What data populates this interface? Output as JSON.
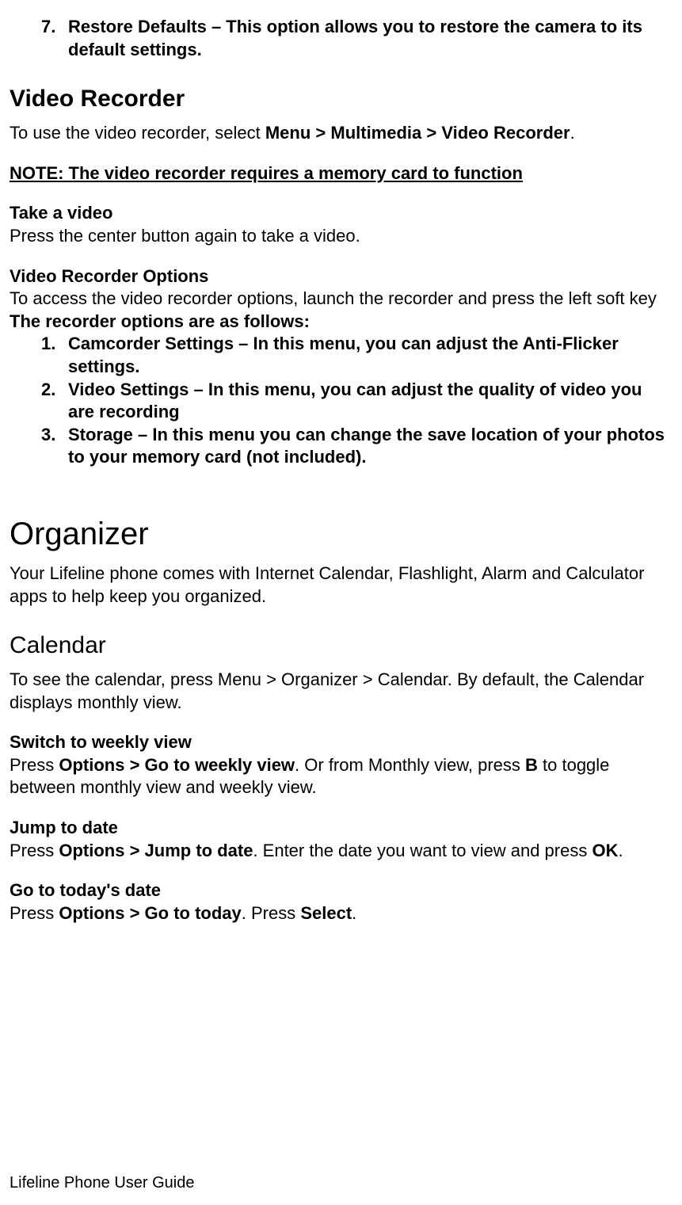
{
  "topList": {
    "num": "7.",
    "text": "Restore Defaults – This option allows you to restore the camera to its default settings."
  },
  "videoRecorder": {
    "heading": "Video Recorder",
    "intro_pre": "To use the video recorder, select ",
    "intro_bold": "Menu > Multimedia > Video Recorder",
    "intro_post": ".",
    "note": "NOTE: The video recorder requires a memory card to function",
    "takeHeading": "Take a video",
    "takeText": "Press the center button again to take a video.",
    "optionsHeading": "Video Recorder Options",
    "optionsText": "To access the video recorder options, launch the recorder and press the left soft key",
    "optionsFollows": "The recorder options are as follows:",
    "items": [
      {
        "num": "1.",
        "text": "Camcorder Settings – In this menu, you can adjust the Anti-Flicker settings."
      },
      {
        "num": "2.",
        "text": "Video Settings – In this menu, you can adjust the quality of video you are recording"
      },
      {
        "num": "3.",
        "text": "Storage – In this menu you can change the save location of your photos to your memory card (not included)."
      }
    ]
  },
  "organizer": {
    "heading": "Organizer",
    "intro": "Your Lifeline phone comes with Internet Calendar, Flashlight, Alarm and Calculator apps to help keep you organized."
  },
  "calendar": {
    "heading": "Calendar",
    "intro": "To see the calendar, press Menu > Organizer > Calendar. By default, the Calendar displays monthly view.",
    "weeklyHeading": "Switch to weekly view",
    "weekly_p1": "Press ",
    "weekly_b1": "Options > Go to weekly view",
    "weekly_p2": ". Or from Monthly view, press ",
    "weekly_b2": "B",
    "weekly_p3": " to toggle between monthly view and weekly view.",
    "jumpHeading": "Jump to date",
    "jump_p1": "Press ",
    "jump_b1": "Options  > Jump to date",
    "jump_p2": ". Enter the date you want to view and press ",
    "jump_b2": "OK",
    "jump_p3": ".",
    "todayHeading": "Go to today's date",
    "today_p1": "Press ",
    "today_b1": "Options > Go to today",
    "today_p2": ". Press ",
    "today_b2": "Select",
    "today_p3": "."
  },
  "footer": "Lifeline Phone User Guide"
}
